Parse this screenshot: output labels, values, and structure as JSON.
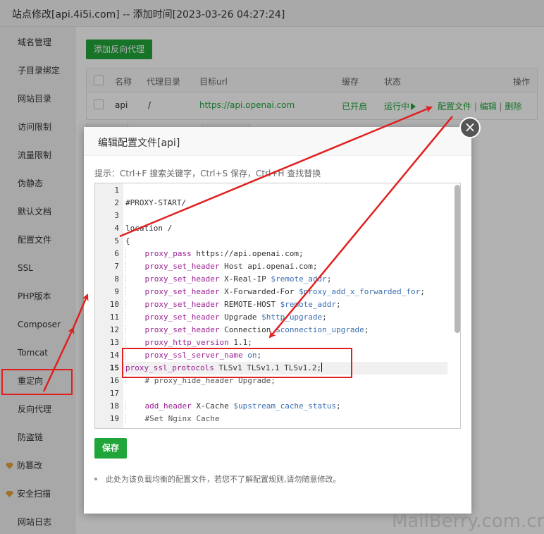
{
  "window": {
    "title": "站点修改[api.4i5i.com] -- 添加时间[2023-03-26 04:27:24]"
  },
  "sidebar": {
    "items": [
      {
        "label": "域名管理"
      },
      {
        "label": "子目录绑定"
      },
      {
        "label": "网站目录"
      },
      {
        "label": "访问限制"
      },
      {
        "label": "流量限制"
      },
      {
        "label": "伪静态"
      },
      {
        "label": "默认文档"
      },
      {
        "label": "配置文件"
      },
      {
        "label": "SSL"
      },
      {
        "label": "PHP版本"
      },
      {
        "label": "Composer"
      },
      {
        "label": "Tomcat"
      },
      {
        "label": "重定向"
      },
      {
        "label": "反向代理"
      },
      {
        "label": "防盗链"
      },
      {
        "label": "防篡改",
        "icon": "gem-icon"
      },
      {
        "label": "安全扫描",
        "icon": "gem-icon"
      },
      {
        "label": "网站日志"
      }
    ],
    "active": "反向代理"
  },
  "proxy": {
    "add_button": "添加反向代理",
    "columns": [
      "名称",
      "代理目录",
      "目标url",
      "缓存",
      "状态",
      "操作"
    ],
    "row": {
      "name": "api",
      "dir": "/",
      "url": "https://api.openai.com",
      "cache": "已开启",
      "status": "运行中",
      "actions": [
        "配置文件",
        "编辑",
        "删除"
      ]
    }
  },
  "modal": {
    "title": "编辑配置文件[api]",
    "close": "×",
    "tip": "提示：Ctrl+F 搜索关键字，Ctrl+S 保存，Ctrl+H 查找替换",
    "save": "保存",
    "note": "此处为该负载均衡的配置文件，若您不了解配置规则,请勿随意修改。"
  },
  "editor": {
    "lines": [
      {
        "n": "1",
        "t": ""
      },
      {
        "n": "2",
        "t": "#PROXY-START/"
      },
      {
        "n": "3",
        "t": ""
      },
      {
        "n": "4",
        "t": "location /"
      },
      {
        "n": "5",
        "t": "{"
      },
      {
        "n": "6",
        "k": "proxy_pass",
        "r": " https://api.openai.com;"
      },
      {
        "n": "7",
        "k": "proxy_set_header",
        "r": " Host api.openai.com;"
      },
      {
        "n": "8",
        "k": "proxy_set_header",
        "r": " X-Real-IP ",
        "v": "$remote_addr",
        "e": ";"
      },
      {
        "n": "9",
        "k": "proxy_set_header",
        "r": " X-Forwarded-For ",
        "v": "$proxy_add_x_forwarded_for",
        "e": ";"
      },
      {
        "n": "10",
        "k": "proxy_set_header",
        "r": " REMOTE-HOST ",
        "v": "$remote_addr",
        "e": ";"
      },
      {
        "n": "11",
        "k": "proxy_set_header",
        "r": " Upgrade ",
        "v": "$http_upgrade",
        "e": ";"
      },
      {
        "n": "12",
        "k": "proxy_set_header",
        "r": " Connection ",
        "v": "$connection_upgrade",
        "e": ";"
      },
      {
        "n": "13",
        "k": "proxy_http_version",
        "r": " 1.1;"
      },
      {
        "n": "14",
        "k": "proxy_ssl_server_name",
        "r": " ",
        "v": "on",
        "e": ";"
      },
      {
        "n": "15",
        "k": "proxy_ssl_protocols",
        "r": " TLSv1 TLSv1.1 TLSv1.2;",
        "active": true
      },
      {
        "n": "16",
        "c": "# proxy_hide_header Upgrade;"
      },
      {
        "n": "17",
        "t": ""
      },
      {
        "n": "18",
        "k": "add_header",
        "r": " X-Cache ",
        "v": "$upstream_cache_status",
        "e": ";"
      },
      {
        "n": "19",
        "c": "#Set Nginx Cache"
      }
    ]
  },
  "watermark": "MailBerry.com.cn",
  "colors": {
    "accent": "#20a53a",
    "annotation": "#e02020",
    "keyword": "#9b2393",
    "variable": "#3a6fb0"
  }
}
